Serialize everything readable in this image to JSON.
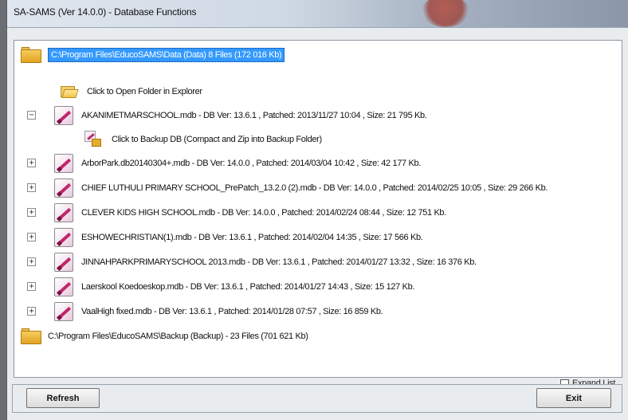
{
  "window": {
    "title": "SA-SAMS (Ver 14.0.0)  - Database Functions"
  },
  "tree": {
    "data_folder_label": "C:\\Program Files\\EducoSAMS\\Data (Data)     8 Files (172 016 Kb)",
    "open_folder_label": "Click to Open Folder in Explorer",
    "expanded_db_label": "AKANIMETMARSCHOOL.mdb   - DB Ver: 13.6.1 , Patched: 2013/11/27 10:04 , Size: 21 795 Kb.",
    "backup_action_label": "Click to Backup DB (Compact and Zip into Backup Folder)",
    "databases": [
      {
        "label": "ArborPark.db20140304+.mdb    - DB Ver: 14.0.0 , Patched: 2014/03/04 10:42 , Size: 42 177 Kb."
      },
      {
        "label": "CHIEF LUTHULI PRIMARY SCHOOL_PrePatch_13.2.0 (2).mdb    - DB Ver: 14.0.0 , Patched: 2014/02/25 10:05 , Size: 29 266 Kb."
      },
      {
        "label": "CLEVER KIDS HIGH SCHOOL.mdb    - DB Ver: 14.0.0 , Patched: 2014/02/24 08:44 , Size: 12 751 Kb."
      },
      {
        "label": "ESHOWECHRISTIAN(1).mdb    - DB Ver: 13.6.1 , Patched: 2014/02/04 14:35 , Size: 17 566 Kb."
      },
      {
        "label": "JINNAHPARKPRIMARYSCHOOL 2013.mdb    - DB Ver: 13.6.1 , Patched: 2014/01/27 13:32 , Size: 16 376 Kb."
      },
      {
        "label": "Laerskool Koedoeskop.mdb    - DB Ver: 13.6.1 , Patched: 2014/01/27 14:43 , Size: 15 127 Kb."
      },
      {
        "label": "VaalHigh fixed.mdb    - DB Ver: 13.6.1 , Patched: 2014/01/28 07:57 , Size: 16 859 Kb."
      }
    ],
    "backup_folder_label": "C:\\Program Files\\EducoSAMS\\Backup (Backup)    - 23 Files (701 621 Kb)"
  },
  "options": {
    "expand_list_label": "Expand List",
    "expand_list_checked": false
  },
  "buttons": {
    "refresh_label": "Refresh",
    "exit_label": "Exit"
  },
  "expander": {
    "collapsed_symbol": "+",
    "expanded_symbol": "−"
  }
}
